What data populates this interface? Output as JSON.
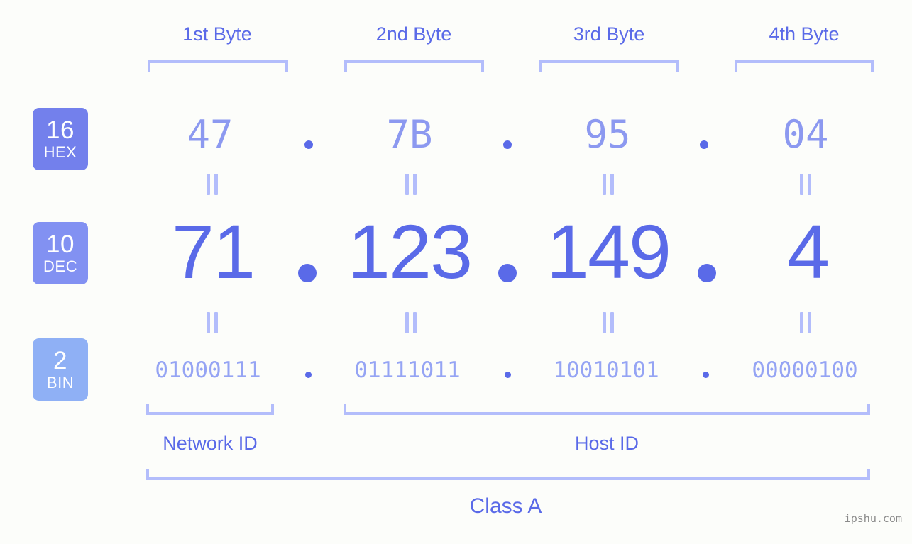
{
  "background_color": "#fcfdfa",
  "accent_color": "#5a6ae8",
  "bracket_color": "#b3bdfb",
  "byte_headers": [
    {
      "label": "1st Byte"
    },
    {
      "label": "2nd Byte"
    },
    {
      "label": "3rd Byte"
    },
    {
      "label": "4th Byte"
    }
  ],
  "rows": [
    {
      "base_number": "16",
      "base_name": "HEX",
      "badge_color": "#7380ec",
      "values": [
        "47",
        "7B",
        "95",
        "04"
      ],
      "separator": "."
    },
    {
      "base_number": "10",
      "base_name": "DEC",
      "badge_color": "#8291f2",
      "values": [
        "71",
        "123",
        "149",
        "4"
      ],
      "separator": "."
    },
    {
      "base_number": "2",
      "base_name": "BIN",
      "badge_color": "#8fb0f5",
      "values": [
        "01000111",
        "01111011",
        "10010101",
        "00000100"
      ],
      "separator": "."
    }
  ],
  "equals_symbol": "||",
  "segments": {
    "network_id": "Network ID",
    "host_id": "Host ID"
  },
  "class_label": "Class A",
  "watermark": "ipshu.com"
}
